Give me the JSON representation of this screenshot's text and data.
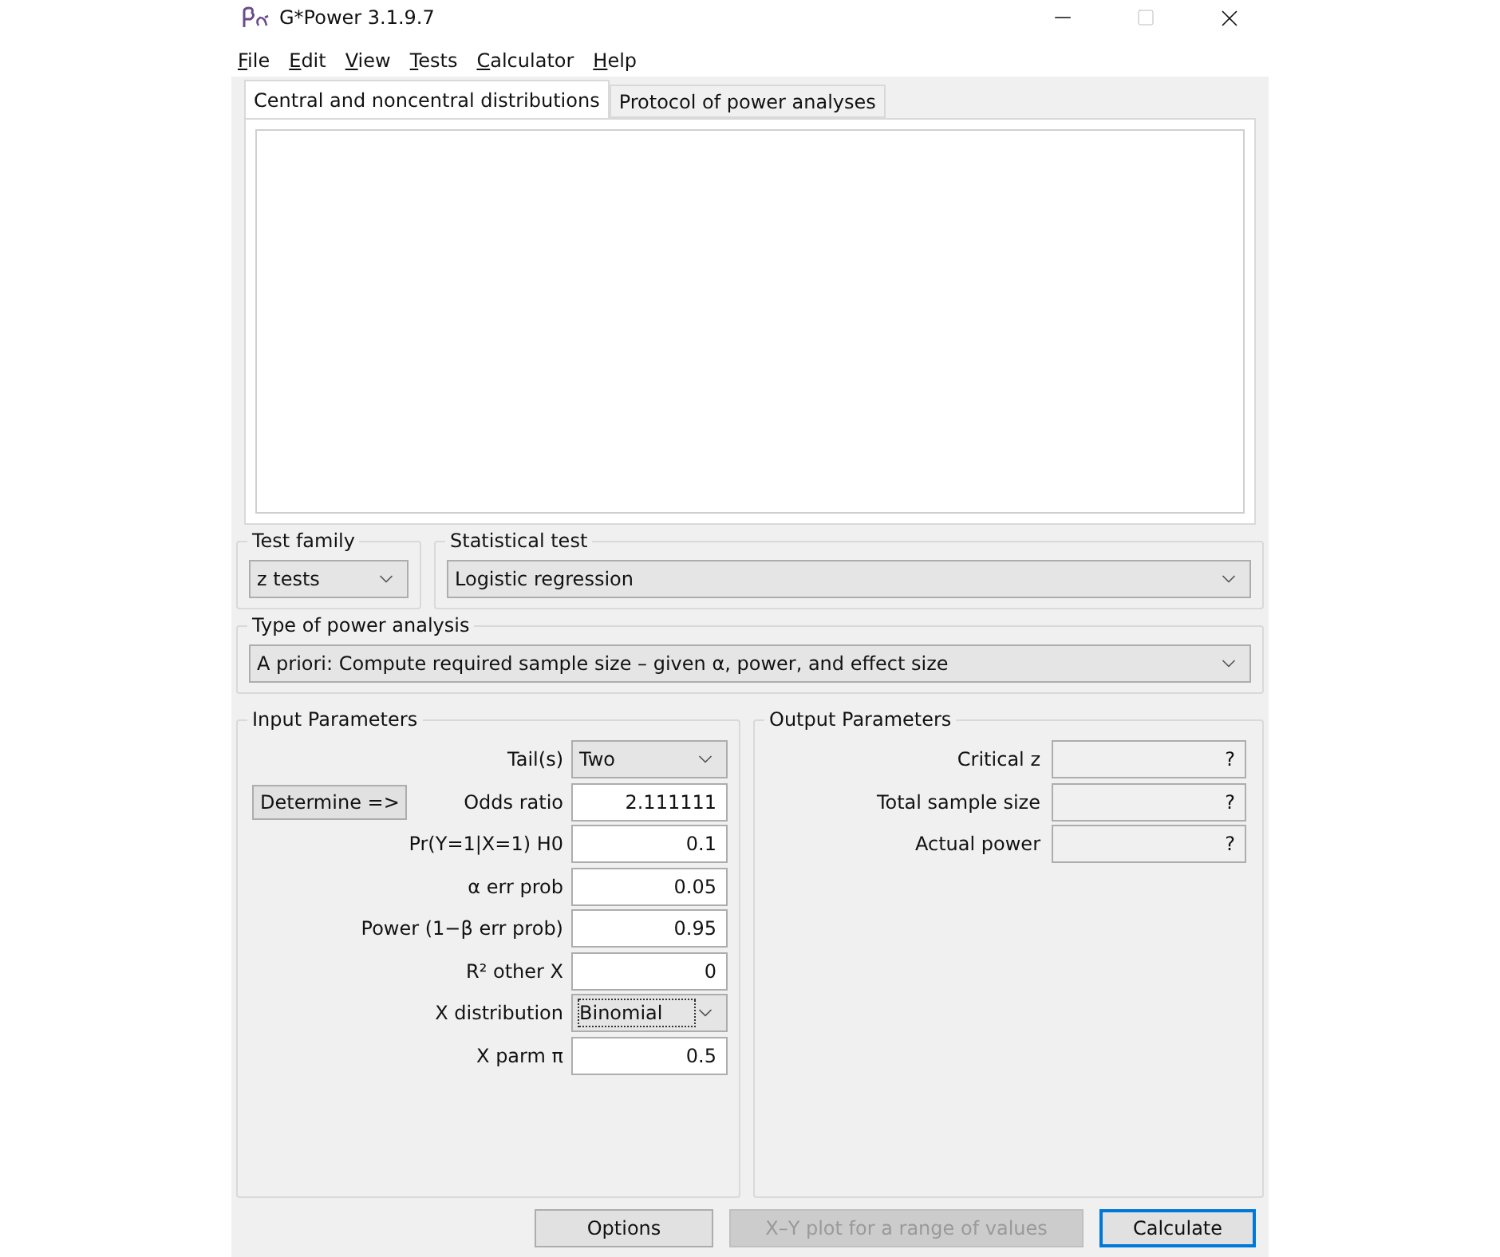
{
  "window": {
    "title": "G*Power 3.1.9.7"
  },
  "menu": [
    "File",
    "Edit",
    "View",
    "Tests",
    "Calculator",
    "Help"
  ],
  "tabs": [
    {
      "label": "Central and noncentral distributions",
      "selected": true
    },
    {
      "label": "Protocol of power analyses",
      "selected": false
    }
  ],
  "test_family": {
    "label": "Test family",
    "value": "z tests"
  },
  "statistical_test": {
    "label": "Statistical test",
    "value": "Logistic regression"
  },
  "power_analysis": {
    "label": "Type of power analysis",
    "value": "A priori: Compute required sample size – given α, power, and effect size"
  },
  "input_parameters": {
    "title": "Input Parameters",
    "rows": [
      {
        "label": "Tail(s)",
        "kind": "select",
        "value": "Two",
        "focused": false
      },
      {
        "label": "Odds ratio",
        "kind": "number",
        "value": "2.111111",
        "button": "Determine =>"
      },
      {
        "label": "Pr(Y=1|X=1) H0",
        "kind": "number",
        "value": "0.1"
      },
      {
        "label": "α err prob",
        "kind": "number",
        "value": "0.05"
      },
      {
        "label": "Power (1−β err prob)",
        "kind": "number",
        "value": "0.95"
      },
      {
        "label": "R² other X",
        "kind": "number",
        "value": "0"
      },
      {
        "label": "X distribution",
        "kind": "select",
        "value": "Binomial",
        "focused": true
      },
      {
        "label": "X parm π",
        "kind": "number",
        "value": "0.5"
      }
    ]
  },
  "output_parameters": {
    "title": "Output Parameters",
    "rows": [
      {
        "label": "Critical z",
        "value": "?"
      },
      {
        "label": "Total sample size",
        "value": "?"
      },
      {
        "label": "Actual power",
        "value": "?"
      }
    ]
  },
  "buttons": [
    {
      "label": "Options",
      "disabled": false,
      "default": false
    },
    {
      "label": "X–Y plot for a range of values",
      "disabled": true,
      "default": false
    },
    {
      "label": "Calculate",
      "disabled": false,
      "default": true
    }
  ]
}
